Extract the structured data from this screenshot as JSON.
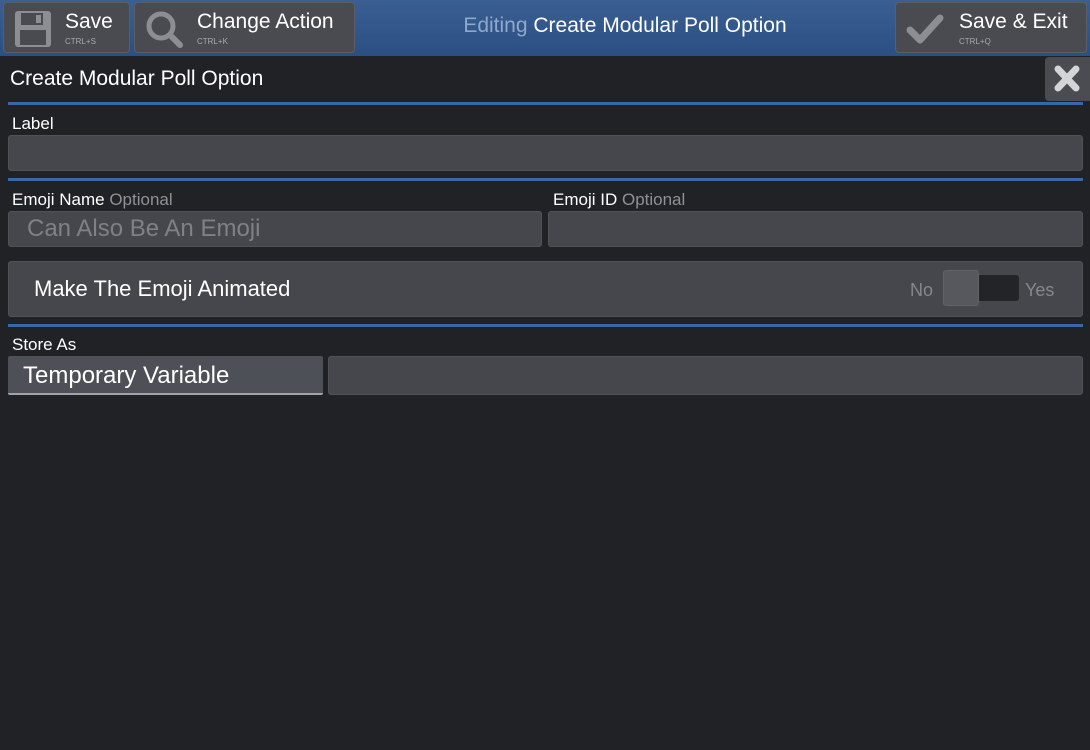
{
  "toolbar": {
    "save_label": "Save",
    "save_shortcut": "CTRL+S",
    "change_action_label": "Change Action",
    "change_action_shortcut": "CTRL+K",
    "editing_prefix": "Editing",
    "editing_name": "Create Modular Poll Option",
    "save_exit_label": "Save & Exit",
    "save_exit_shortcut": "CTRL+Q"
  },
  "panel": {
    "title": "Create Modular Poll Option"
  },
  "form": {
    "label": {
      "label": "Label",
      "value": "",
      "placeholder": ""
    },
    "emoji_name": {
      "label": "Emoji Name",
      "optional": "Optional",
      "value": "",
      "placeholder": "Can Also Be An Emoji"
    },
    "emoji_id": {
      "label": "Emoji ID",
      "optional": "Optional",
      "value": "",
      "placeholder": ""
    },
    "animated": {
      "label": "Make The Emoji Animated",
      "no": "No",
      "yes": "Yes",
      "value": false
    },
    "store_as": {
      "label": "Store As",
      "type": "Temporary Variable",
      "value": "",
      "placeholder": ""
    }
  },
  "colors": {
    "background": "#202226",
    "topbar": "#2f5488",
    "accent_divider": "#3a67a8",
    "input_bg": "#45474c",
    "optional_text": "#8f9196"
  },
  "icons": {
    "save": "floppy-disk-icon",
    "change_action": "magnifier-icon",
    "save_exit": "checkmark-icon",
    "close": "close-x-icon"
  }
}
